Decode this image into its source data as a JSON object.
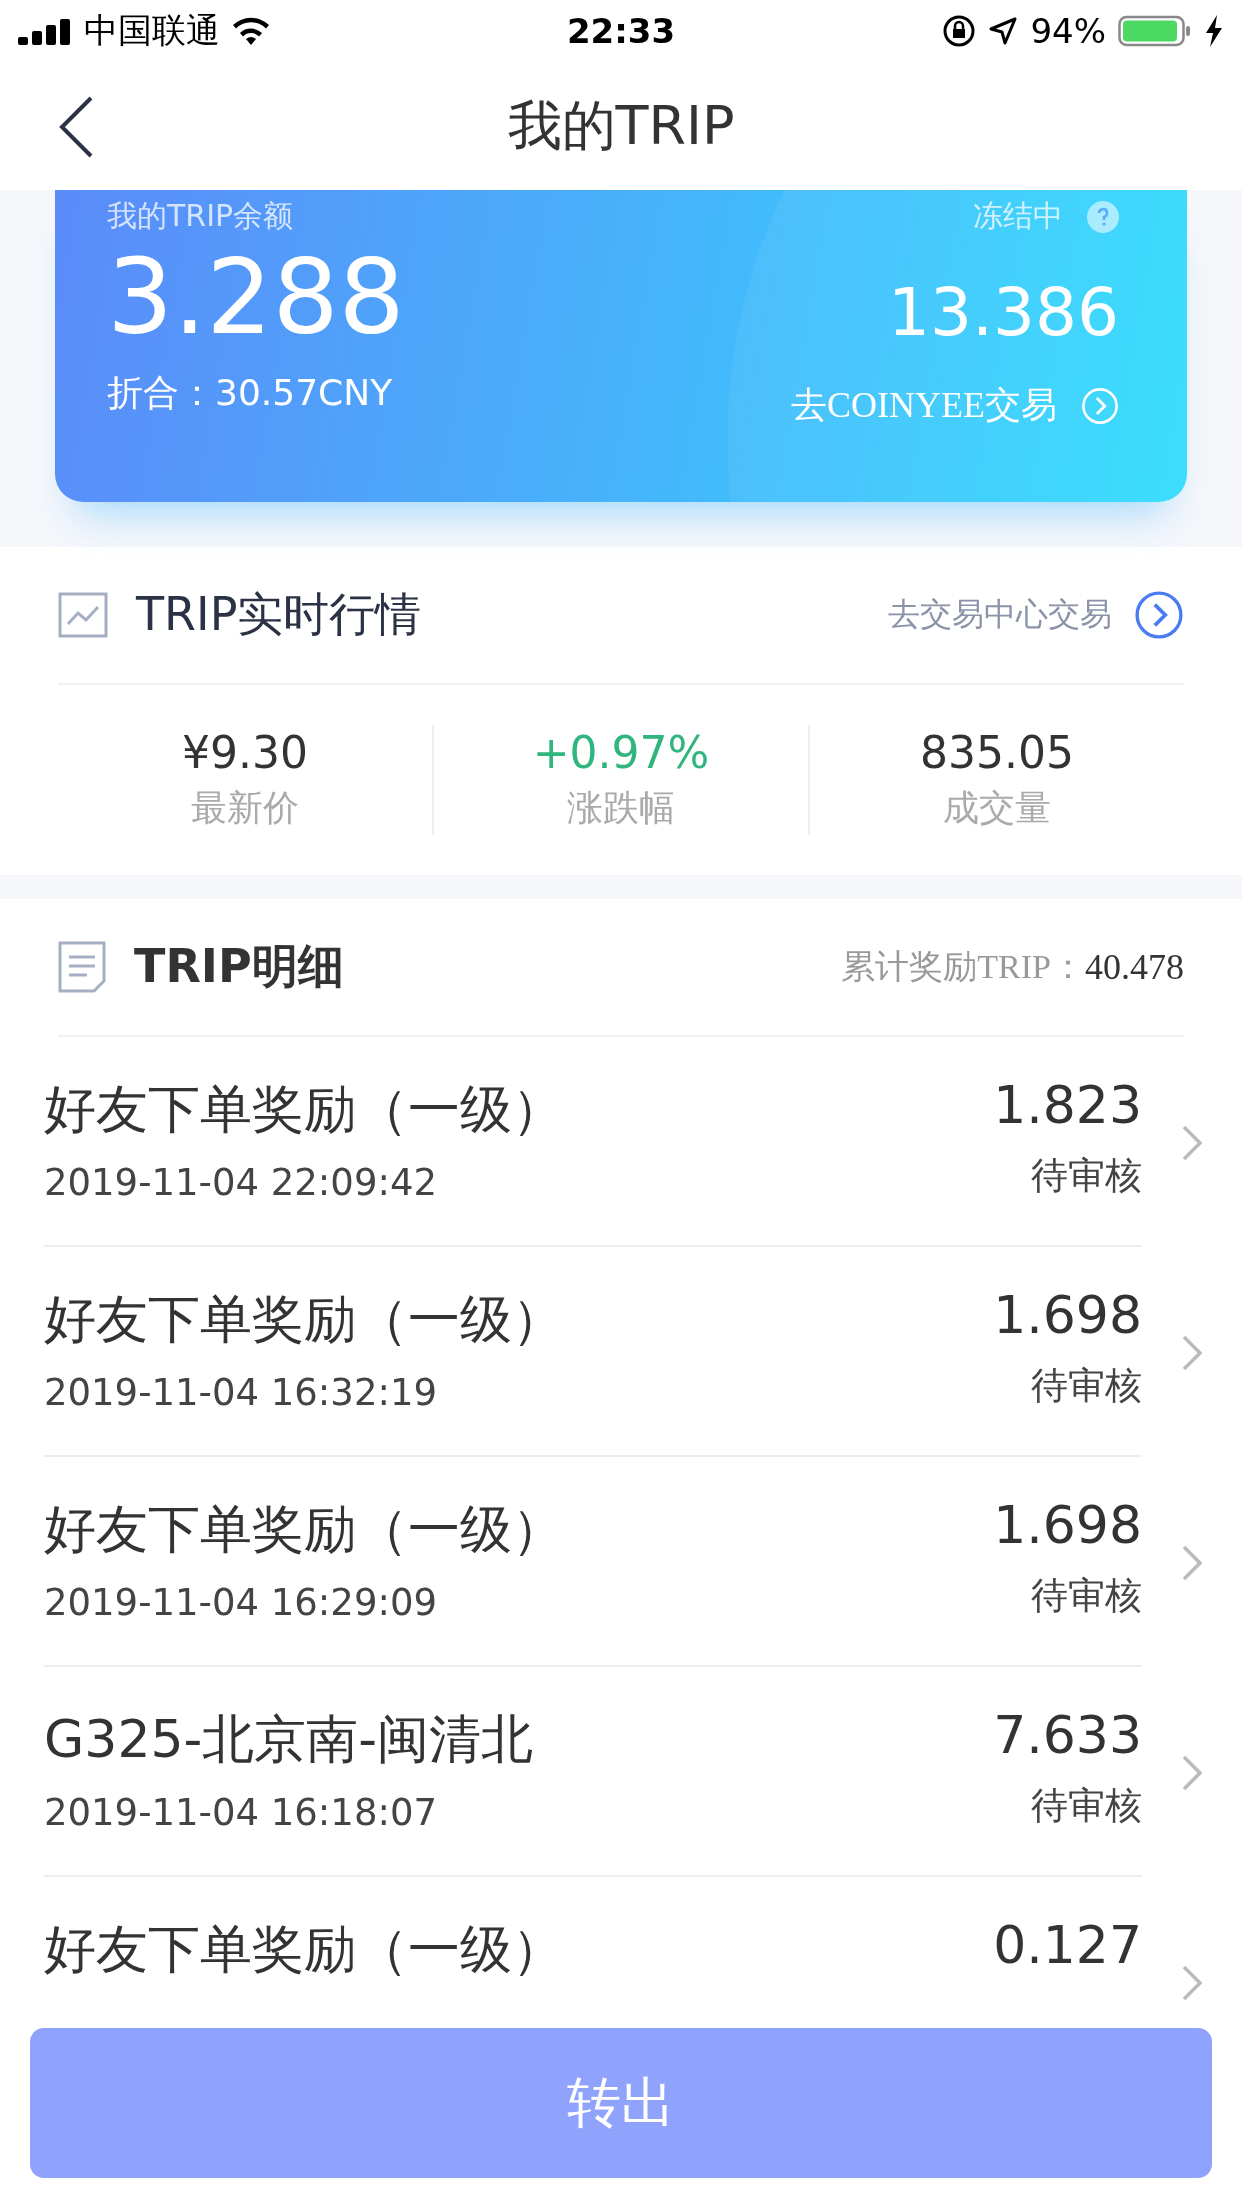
{
  "status_bar": {
    "carrier": "中国联通",
    "time": "22:33",
    "battery": "94%"
  },
  "nav": {
    "title": "我的TRIP"
  },
  "balance_card": {
    "label": "我的TRIP余额",
    "amount": "3.288",
    "converted": "折合：30.57CNY",
    "frozen_label": "冻结中",
    "frozen_amount": "13.386",
    "trade_link": "去COINYEE交易"
  },
  "market": {
    "title": "TRIP实时行情",
    "link": "去交易中心交易",
    "stats": [
      {
        "value": "¥9.30",
        "label": "最新价",
        "kind": "plain"
      },
      {
        "value": "+0.97%",
        "label": "涨跌幅",
        "kind": "up"
      },
      {
        "value": "835.05",
        "label": "成交量",
        "kind": "plain"
      }
    ]
  },
  "details": {
    "title": "TRIP明细",
    "total_label": "累计奖励TRIP：",
    "total_value": "40.478",
    "rows": [
      {
        "title": "好友下单奖励（一级）",
        "time": "2019-11-04 22:09:42",
        "amount": "1.823",
        "status": "待审核"
      },
      {
        "title": "好友下单奖励（一级）",
        "time": "2019-11-04 16:32:19",
        "amount": "1.698",
        "status": "待审核"
      },
      {
        "title": "好友下单奖励（一级）",
        "time": "2019-11-04 16:29:09",
        "amount": "1.698",
        "status": "待审核"
      },
      {
        "title": "G325-北京南-闽清北",
        "time": "2019-11-04 16:18:07",
        "amount": "7.633",
        "status": "待审核"
      },
      {
        "title": "好友下单奖励（一级）",
        "amount": "0.127"
      }
    ]
  },
  "button": {
    "label": "转出"
  }
}
